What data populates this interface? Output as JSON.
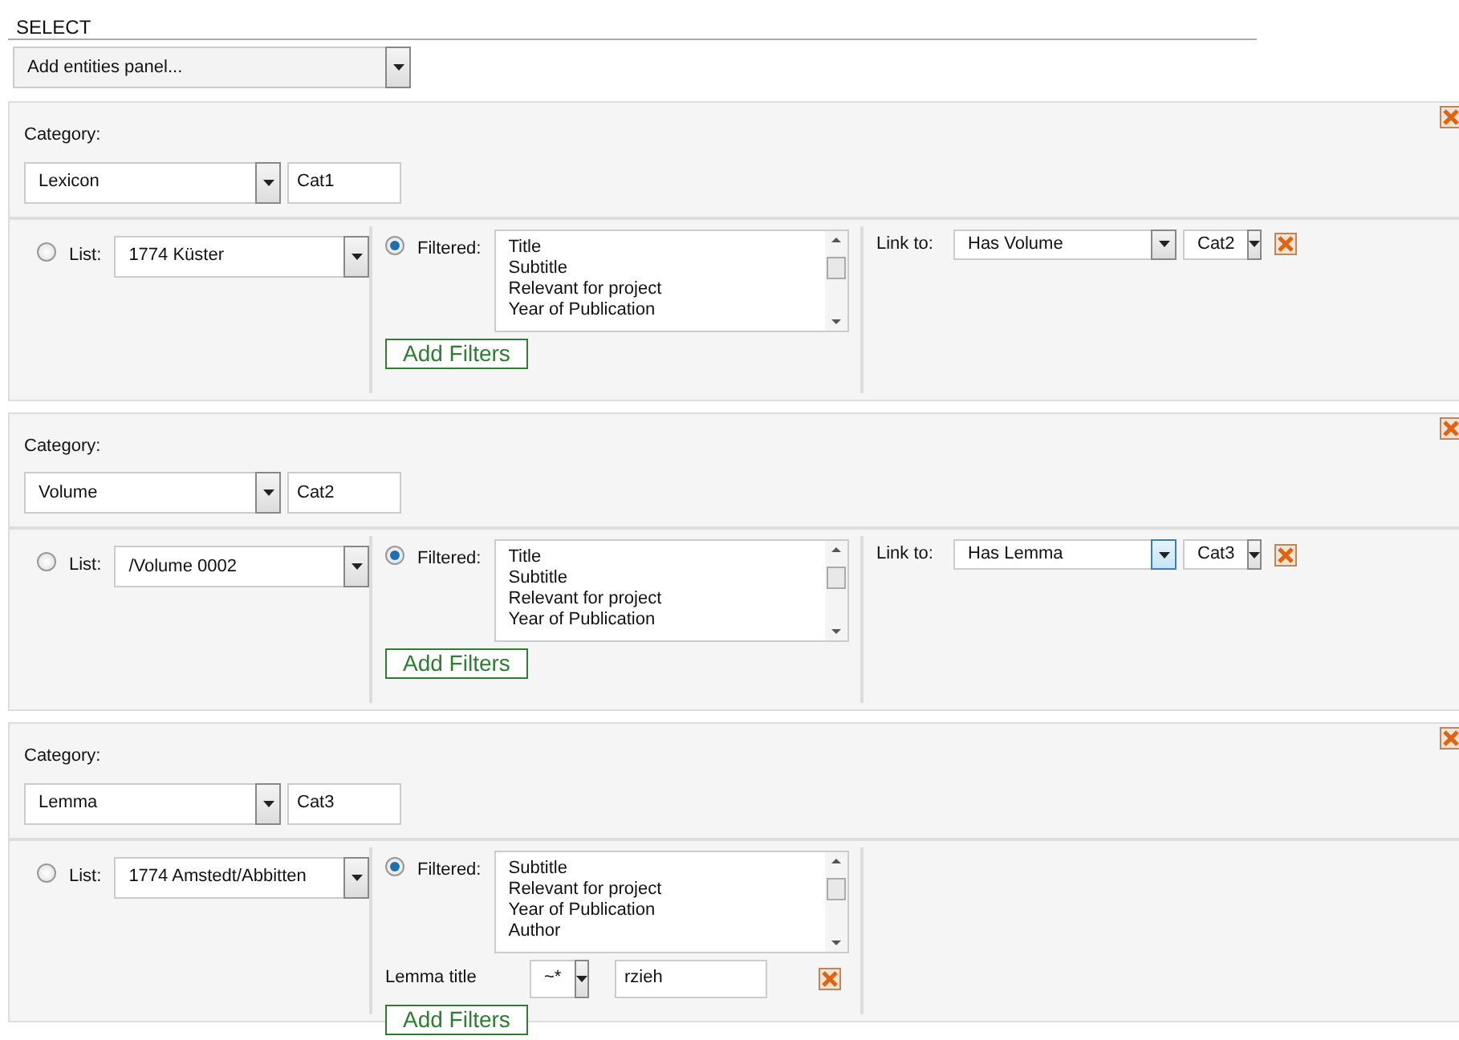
{
  "title": "SELECT",
  "add_panel": {
    "value": "Add entities panel..."
  },
  "panels": [
    {
      "category_label": "Category:",
      "category": "Lexicon",
      "alias": "Cat1",
      "list_label": "List:",
      "list_selected": false,
      "list_value": "1774 Küster",
      "filtered_label": "Filtered:",
      "filtered_selected": true,
      "filter_fields": [
        "Title",
        "Subtitle",
        "Relevant for project",
        "Year of Publication"
      ],
      "add_filters": "Add Filters",
      "link": {
        "label": "Link to:",
        "relation": "Has Volume",
        "relation_focused": false,
        "target": "Cat2"
      }
    },
    {
      "category_label": "Category:",
      "category": "Volume",
      "alias": "Cat2",
      "list_label": "List:",
      "list_selected": false,
      "list_value": "/Volume 0002",
      "filtered_label": "Filtered:",
      "filtered_selected": true,
      "filter_fields": [
        "Title",
        "Subtitle",
        "Relevant for project",
        "Year of Publication"
      ],
      "add_filters": "Add Filters",
      "link": {
        "label": "Link to:",
        "relation": "Has Lemma",
        "relation_focused": true,
        "target": "Cat3"
      }
    },
    {
      "category_label": "Category:",
      "category": "Lemma",
      "alias": "Cat3",
      "list_label": "List:",
      "list_selected": false,
      "list_value": "1774 Amstedt/Abbitten",
      "filtered_label": "Filtered:",
      "filtered_selected": true,
      "filter_fields": [
        "Subtitle",
        "Relevant for project",
        "Year of Publication",
        "Author"
      ],
      "filters": [
        {
          "label": "Lemma title",
          "operator": "~*",
          "value": "rzieh"
        }
      ],
      "add_filters": "Add Filters"
    }
  ]
}
